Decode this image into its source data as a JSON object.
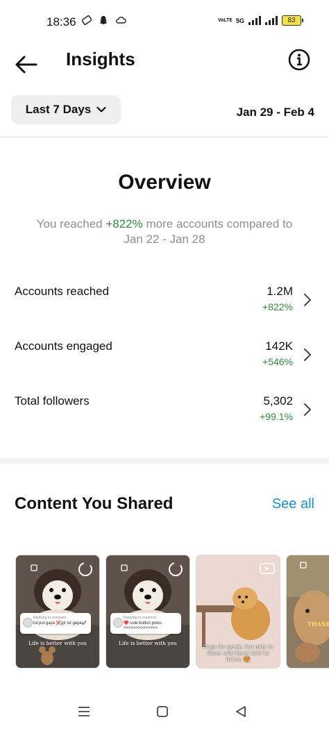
{
  "status_bar": {
    "time": "18:36",
    "network_label": "VoLTE",
    "network_type": "5G",
    "battery": "83"
  },
  "header": {
    "title": "Insights",
    "back_icon": "arrow-left-icon",
    "info_icon": "info-circle-icon"
  },
  "filter": {
    "range_label": "Last 7 Days",
    "date_range": "Jan 29 - Feb 4"
  },
  "overview": {
    "title": "Overview",
    "subtitle_prefix": "You reached ",
    "subtitle_highlight": "+822%",
    "subtitle_suffix": " more accounts compared to Jan 22 - Jan 28",
    "metrics": [
      {
        "label": "Accounts reached",
        "value": "1.2M",
        "change": "+822%"
      },
      {
        "label": "Accounts engaged",
        "value": "142K",
        "change": "+546%"
      },
      {
        "label": "Total followers",
        "value": "5,302",
        "change": "+99.1%"
      }
    ]
  },
  "content": {
    "title": "Content You Shared",
    "see_all": "See all",
    "thumbnails": [
      {
        "comment_user": "Replying to comment",
        "comment_text": "lut put gaya ❌gir lut gaya✔️",
        "caption": "Life is better with you"
      },
      {
        "comment_user": "Replying to comment",
        "comment_text": "❤️ cute button press >>>>>>>>>>>>>>",
        "caption": "Life is better with you"
      },
      {
        "caption": "Dogs do speak, but only to those who know how to listen. 😍"
      },
      {
        "caption": "THANK"
      }
    ]
  },
  "colors": {
    "accent_green": "#2e8b3e",
    "link_blue": "#1a8fd6",
    "muted_text": "#8e8e8e"
  }
}
